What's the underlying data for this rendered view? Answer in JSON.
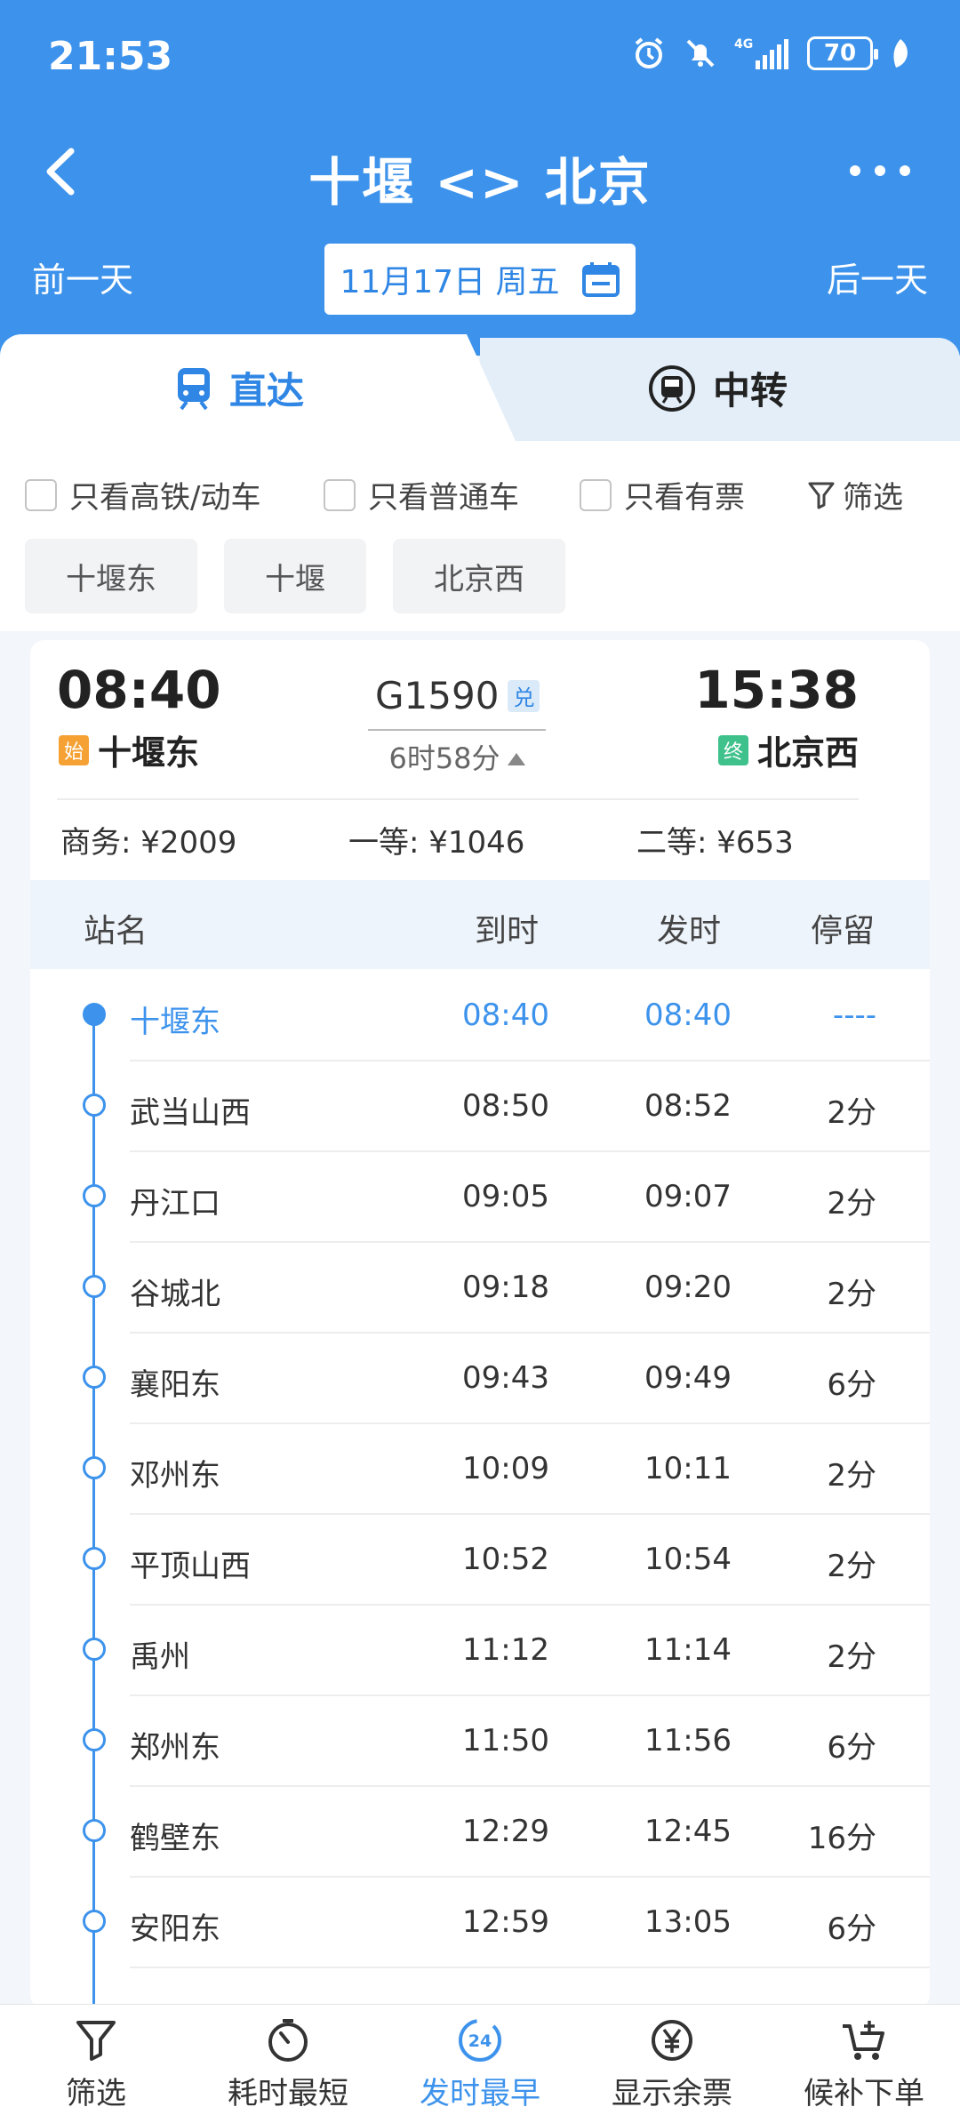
{
  "status_bar": {
    "time": "21:53",
    "battery": "70",
    "network": "4G"
  },
  "nav": {
    "title": "十堰 <> 北京"
  },
  "date_bar": {
    "prev_label": "前一天",
    "next_label": "后一天",
    "date": "11月17日 周五"
  },
  "tabs": {
    "direct": "直达",
    "transfer": "中转"
  },
  "filters": {
    "high_speed": "只看高铁/动车",
    "normal": "只看普通车",
    "available": "只看有票",
    "filter_label": "筛选"
  },
  "station_chips": [
    "十堰东",
    "十堰",
    "北京西"
  ],
  "train": {
    "number": "G1590",
    "exchange_badge": "兑",
    "duration": "6时58分",
    "dep_time": "08:40",
    "dep_station": "十堰东",
    "dep_tag": "始",
    "arr_time": "15:38",
    "arr_station": "北京西",
    "arr_tag": "终",
    "prices": {
      "business": "商务: ¥2009",
      "first": "一等: ¥1046",
      "second": "二等: ¥653"
    }
  },
  "stop_table": {
    "headers": {
      "name": "站名",
      "arrive": "到时",
      "depart": "发时",
      "stay": "停留"
    },
    "rows": [
      {
        "name": "十堰东",
        "arrive": "08:40",
        "depart": "08:40",
        "stay": "----"
      },
      {
        "name": "武当山西",
        "arrive": "08:50",
        "depart": "08:52",
        "stay": "2分"
      },
      {
        "name": "丹江口",
        "arrive": "09:05",
        "depart": "09:07",
        "stay": "2分"
      },
      {
        "name": "谷城北",
        "arrive": "09:18",
        "depart": "09:20",
        "stay": "2分"
      },
      {
        "name": "襄阳东",
        "arrive": "09:43",
        "depart": "09:49",
        "stay": "6分"
      },
      {
        "name": "邓州东",
        "arrive": "10:09",
        "depart": "10:11",
        "stay": "2分"
      },
      {
        "name": "平顶山西",
        "arrive": "10:52",
        "depart": "10:54",
        "stay": "2分"
      },
      {
        "name": "禹州",
        "arrive": "11:12",
        "depart": "11:14",
        "stay": "2分"
      },
      {
        "name": "郑州东",
        "arrive": "11:50",
        "depart": "11:56",
        "stay": "6分"
      },
      {
        "name": "鹤壁东",
        "arrive": "12:29",
        "depart": "12:45",
        "stay": "16分"
      },
      {
        "name": "安阳东",
        "arrive": "12:59",
        "depart": "13:05",
        "stay": "6分"
      }
    ]
  },
  "bottom_bar": {
    "items": [
      "筛选",
      "耗时最短",
      "发时最早",
      "显示余票",
      "候补下单"
    ],
    "badge_24": "24"
  },
  "colors": {
    "primary": "#3d93ec",
    "start_tag": "#f5a134",
    "end_tag": "#3fc18c"
  }
}
